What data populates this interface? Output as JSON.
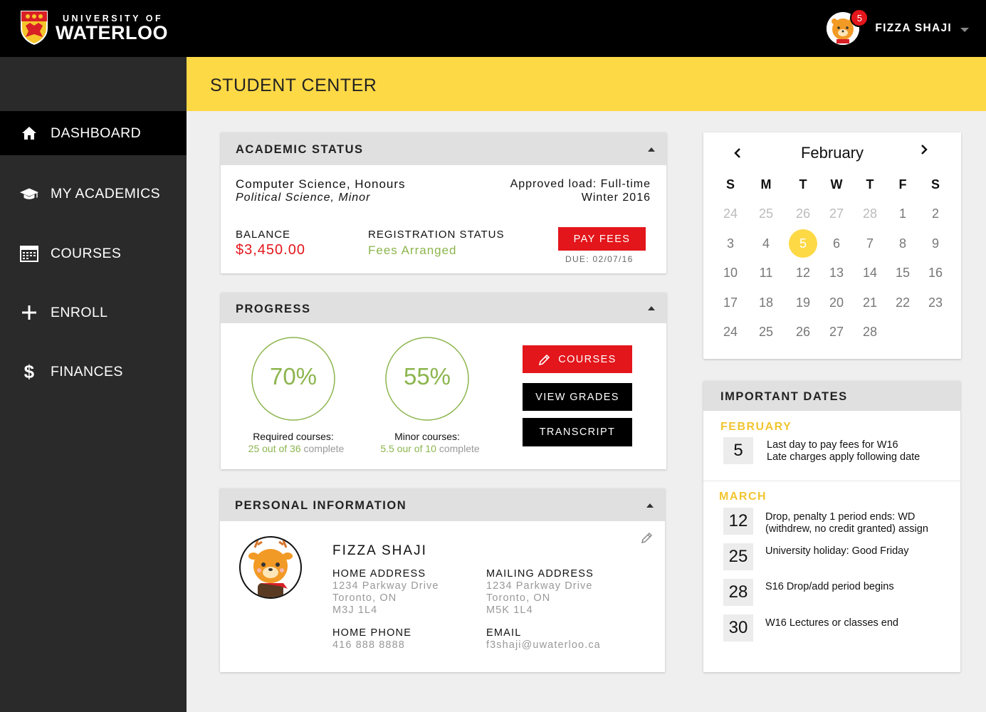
{
  "brand": {
    "university_of": "UNIVERSITY OF",
    "waterloo": "WATERLOO"
  },
  "user": {
    "name": "FIZZA SHAJI",
    "notifications": "5"
  },
  "sidebar": {
    "items": [
      {
        "label": "DASHBOARD",
        "icon": "home-icon",
        "active": true
      },
      {
        "label": "MY ACADEMICS",
        "icon": "graduation-cap-icon"
      },
      {
        "label": "COURSES",
        "icon": "calendar-grid-icon"
      },
      {
        "label": "ENROLL",
        "icon": "plus-icon"
      },
      {
        "label": "FINANCES",
        "icon": "dollar-icon"
      }
    ]
  },
  "page": {
    "title": "STUDENT CENTER"
  },
  "academic": {
    "title": "ACADEMIC STATUS",
    "program": "Computer Science, Honours",
    "minor": "Political Science, Minor",
    "load": "Approved load: Full-time",
    "term": "Winter 2016",
    "balance_label": "BALANCE",
    "balance_value": "$3,450.00",
    "reg_label": "REGISTRATION STATUS",
    "reg_value": "Fees Arranged",
    "pay_button": "PAY FEES",
    "due": "DUE: 02/07/16"
  },
  "progress": {
    "title": "PROGRESS",
    "required": {
      "percent_label": "70%",
      "fraction": 0.7,
      "caption": "Required courses:",
      "done": "25 out of ",
      "total": "36",
      "suffix": " complete"
    },
    "minor": {
      "percent_label": "55%",
      "fraction": 0.55,
      "caption": "Minor courses:",
      "done": "5.5 our of ",
      "total": "10",
      "suffix": " complete"
    },
    "courses_button": "COURSES",
    "grades_button": "VIEW GRADES",
    "transcript_button": "TRANSCRIPT"
  },
  "personal": {
    "title": "PERSONAL INFORMATION",
    "name": "FIZZA SHAJI",
    "home_address_label": "HOME ADDRESS",
    "home_address": [
      "1234 Parkway Drive",
      "Toronto, ON",
      "M3J 1L4"
    ],
    "mailing_address_label": "MAILING ADDRESS",
    "mailing_address": [
      "1234 Parkway Drive",
      "Toronto, ON",
      "M5K 1L4"
    ],
    "phone_label": "HOME PHONE",
    "phone": "416 888 8888",
    "email_label": "EMAIL",
    "email": "f3shaji@uwaterloo.ca"
  },
  "calendar": {
    "month": "February",
    "prev": "‹",
    "next": "›",
    "weekdays": [
      "S",
      "M",
      "T",
      "W",
      "T",
      "F",
      "S"
    ],
    "weeks": [
      [
        "24",
        "25",
        "26",
        "27",
        "28",
        "1",
        "2"
      ],
      [
        "3",
        "4",
        "5",
        "6",
        "7",
        "8",
        "9"
      ],
      [
        "10",
        "11",
        "12",
        "13",
        "14",
        "15",
        "16"
      ],
      [
        "17",
        "18",
        "19",
        "20",
        "21",
        "22",
        "23"
      ],
      [
        "24",
        "25",
        "26",
        "27",
        "28",
        "",
        ""
      ]
    ],
    "selected": "5",
    "accent": "#fed946"
  },
  "important": {
    "title": "IMPORTANT DATES",
    "groups": [
      {
        "month": "FEBRUARY",
        "items": [
          {
            "day": "5",
            "lines": [
              "Last day to pay fees for W16",
              "Late charges apply following date"
            ]
          }
        ]
      },
      {
        "month": "MARCH",
        "items": [
          {
            "day": "12",
            "lines": [
              "Drop, penalty 1 period ends: WD",
              "(withdrew, no credit granted) assign"
            ]
          },
          {
            "day": "25",
            "lines": [
              "University holiday: Good Friday"
            ]
          },
          {
            "day": "28",
            "lines": [
              "S16 Drop/add period begins"
            ]
          },
          {
            "day": "30",
            "lines": [
              "W16 Lectures or classes end"
            ]
          }
        ]
      }
    ]
  },
  "colors": {
    "accent_yellow": "#fed946",
    "red": "#e3161b",
    "green": "#8cb54e",
    "month_label": "#f2c531"
  }
}
